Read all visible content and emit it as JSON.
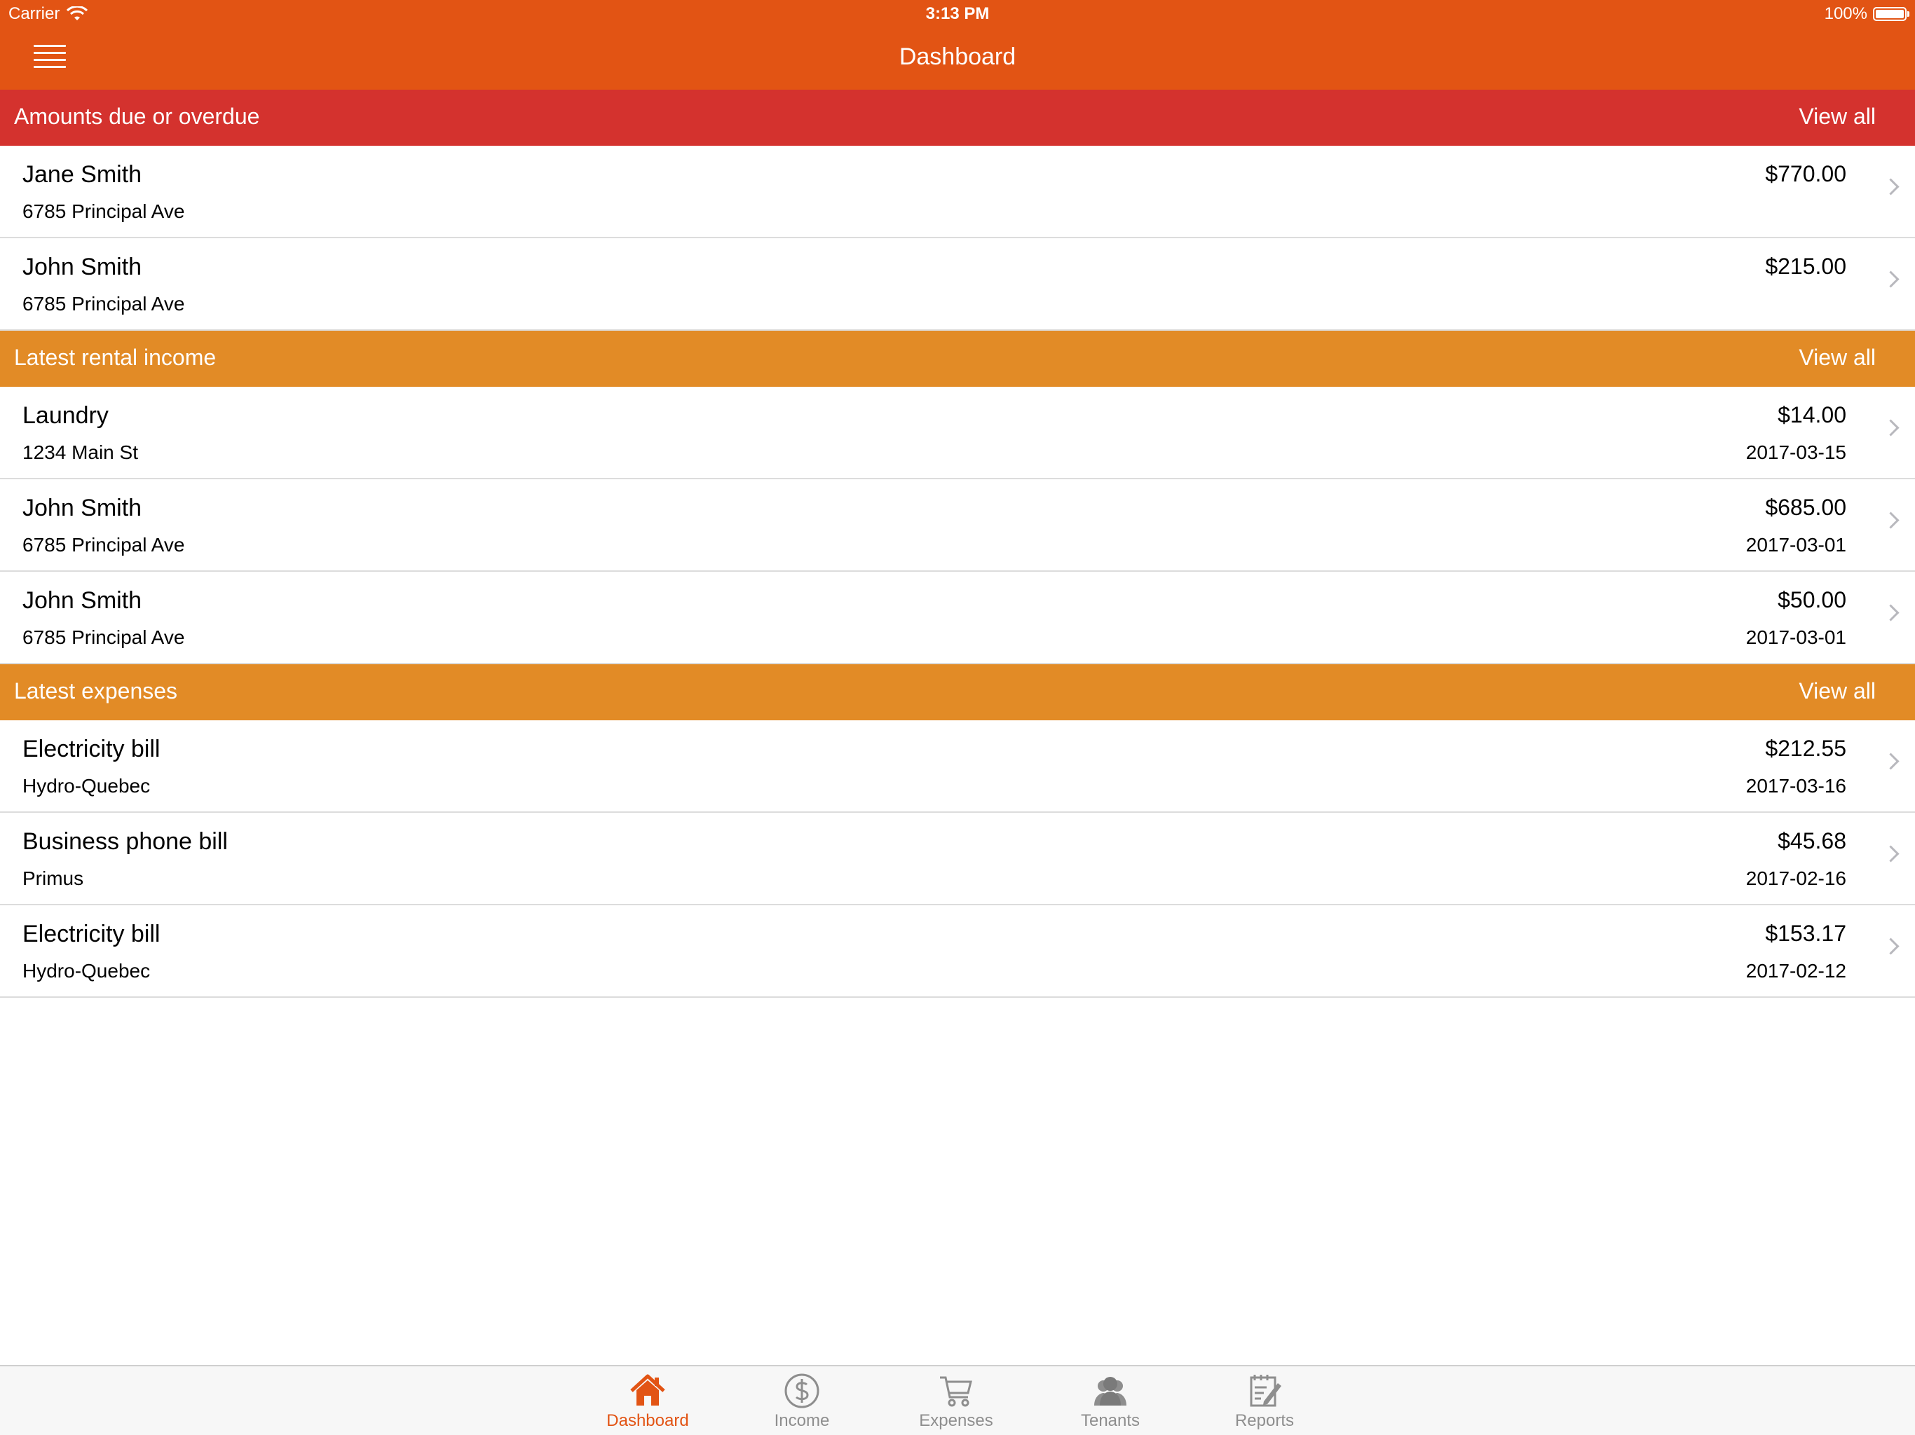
{
  "status_bar": {
    "carrier": "Carrier",
    "time": "3:13 PM",
    "battery": "100%"
  },
  "nav": {
    "title": "Dashboard"
  },
  "colors": {
    "nav": "#e25414",
    "due_header": "#d4322e",
    "section_header": "#e28b26",
    "tab_active": "#e25414",
    "tab_inactive": "#8e8e8e"
  },
  "sections": {
    "due": {
      "title": "Amounts due or overdue",
      "view_all": "View all",
      "rows": [
        {
          "name": "Jane Smith",
          "address": "6785 Principal Ave",
          "amount": "$770.00"
        },
        {
          "name": "John Smith",
          "address": "6785 Principal Ave",
          "amount": "$215.00"
        }
      ]
    },
    "income": {
      "title": "Latest rental income",
      "view_all": "View all",
      "rows": [
        {
          "name": "Laundry",
          "address": "1234 Main St",
          "amount": "$14.00",
          "date": "2017-03-15"
        },
        {
          "name": "John Smith",
          "address": "6785 Principal Ave",
          "amount": "$685.00",
          "date": "2017-03-01"
        },
        {
          "name": "John Smith",
          "address": "6785 Principal Ave",
          "amount": "$50.00",
          "date": "2017-03-01"
        }
      ]
    },
    "expenses": {
      "title": "Latest expenses",
      "view_all": "View all",
      "rows": [
        {
          "name": "Electricity bill",
          "payee": "Hydro-Quebec",
          "amount": "$212.55",
          "date": "2017-03-16"
        },
        {
          "name": "Business phone bill",
          "payee": "Primus",
          "amount": "$45.68",
          "date": "2017-02-16"
        },
        {
          "name": "Electricity bill",
          "payee": "Hydro-Quebec",
          "amount": "$153.17",
          "date": "2017-02-12"
        }
      ]
    }
  },
  "tabbar": {
    "tabs": [
      {
        "label": "Dashboard",
        "icon": "home-icon",
        "active": true
      },
      {
        "label": "Income",
        "icon": "dollar-circle-icon",
        "active": false
      },
      {
        "label": "Expenses",
        "icon": "shopping-cart-icon",
        "active": false
      },
      {
        "label": "Tenants",
        "icon": "people-icon",
        "active": false
      },
      {
        "label": "Reports",
        "icon": "report-edit-icon",
        "active": false
      }
    ]
  }
}
